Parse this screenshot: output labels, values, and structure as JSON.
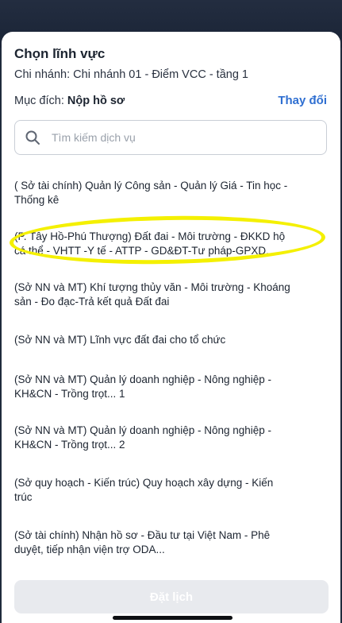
{
  "sheet": {
    "title": "Chọn lĩnh vực",
    "branch": "Chi nhánh: Chi nhánh 01 - Điểm VCC  - tầng 1",
    "purpose_label": "Mục đích: ",
    "purpose_value": "Nộp hồ sơ",
    "change_label": "Thay đổi"
  },
  "search": {
    "placeholder": "Tìm kiếm dịch vụ",
    "icon": "search-icon"
  },
  "items": [
    {
      "line1": "( Sở tài chính) Quản lý Công sản - Quản lý Giá - Tin học -",
      "line2": "Thống kê"
    },
    {
      "line1": "(P. Tây Hồ-Phú Thượng) Đất đai - Môi trường - ĐKKD hộ",
      "line2": "cá thể - VHTT -Y tế - ATTP - GD&ĐT-Tư pháp-GPXD..."
    },
    {
      "line1": "(Sở NN và MT) Khí tượng thủy văn - Môi trường - Khoáng",
      "line2": "sản - Đo đạc-Trả kết quả Đất đai"
    },
    {
      "line1": "(Sở NN và MT) Lĩnh vực đất đai cho tổ chức",
      "line2": ""
    },
    {
      "line1": "(Sở NN và MT) Quản lý doanh nghiệp - Nông nghiệp -",
      "line2": "KH&CN - Trồng trọt... 1"
    },
    {
      "line1": "(Sở NN và MT) Quản lý doanh nghiệp - Nông nghiệp -",
      "line2": "KH&CN - Trồng trọt... 2"
    },
    {
      "line1": "(Sở quy hoạch - Kiến trúc) Quy hoạch xây dựng - Kiến",
      "line2": "trúc"
    },
    {
      "line1": "(Sở tài chính) Nhận hồ sơ - Đầu tư tại Việt Nam - Phê",
      "line2": "duyệt, tiếp nhận viện trợ ODA..."
    }
  ],
  "footer": {
    "book_label": "Đặt lịch"
  },
  "colors": {
    "accent": "#2f6fd1",
    "highlight": "#f4f000",
    "disabled_button": "#e8eaee"
  }
}
